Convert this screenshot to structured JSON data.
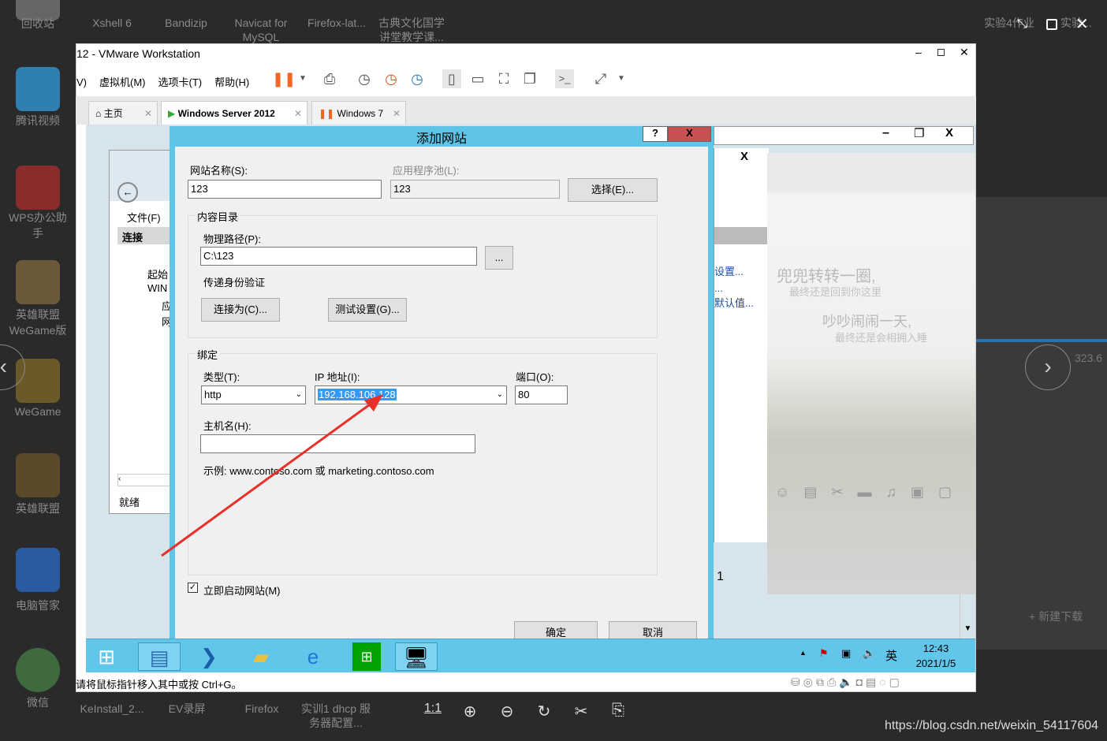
{
  "desktop": {
    "left_icons": [
      "回收站",
      "腾讯视频",
      "WPS办公助手",
      "英雄联盟WeGame版",
      "WeGame",
      "英雄联盟",
      "电脑管家",
      "微信"
    ],
    "top_icons": [
      "Xshell 6",
      "Bandizip",
      "Navicat for MySQL",
      "Firefox-lat...",
      "古典文化国学讲堂教学课..."
    ],
    "top_right": [
      "实验4作业",
      "实验..."
    ]
  },
  "vmware": {
    "title": "12 - VMware Workstation",
    "menu": [
      "V)",
      "虚拟机(M)",
      "选项卡(T)",
      "帮助(H)"
    ],
    "tabs": [
      {
        "label": "主页"
      },
      {
        "label": "Windows Server 2012"
      },
      {
        "label": "Windows 7"
      }
    ],
    "status": "请将鼠标指针移入其中或按 Ctrl+G。"
  },
  "iis": {
    "file_menu": "文件(F)",
    "connections": "连接",
    "tree": [
      "起始",
      "WIN",
      "应",
      "网"
    ],
    "status": "就绪",
    "links": [
      "设置...",
      "...",
      "默认值..."
    ],
    "num": "1"
  },
  "dialog": {
    "title": "添加网站",
    "help": "?",
    "close": "X",
    "site_name_label": "网站名称(S):",
    "site_name": "123",
    "app_pool_label": "应用程序池(L):",
    "app_pool": "123",
    "select_btn": "选择(E)...",
    "content_dir": "内容目录",
    "physical_path_label": "物理路径(P):",
    "physical_path": "C:\\123",
    "browse_btn": "...",
    "passthrough": "传递身份验证",
    "connect_as": "连接为(C)...",
    "test_settings": "测试设置(G)...",
    "binding": "绑定",
    "type_label": "类型(T):",
    "type": "http",
    "ip_label": "IP 地址(I):",
    "ip": "192.168.106.128",
    "port_label": "端口(O):",
    "port": "80",
    "host_label": "主机名(H):",
    "host": "",
    "example": "示例: www.contoso.com 或 marketing.contoso.com",
    "start_now": "立即启动网站(M)",
    "start_checked": true,
    "ok": "确定",
    "cancel": "取消"
  },
  "guest_taskbar": {
    "time": "12:43",
    "date": "2021/1/5",
    "ime": "英"
  },
  "viewer": {
    "labels": [
      "KeInstall_2...",
      "EV录屏",
      "Firefox",
      "实训1 dhcp 服务器配置..."
    ],
    "actual_size": "1:1",
    "side_value": "323.6",
    "new_download": "+ 新建下载",
    "image_text": [
      "兜兜转转一圈,",
      "最终还是回到你这里",
      "吵吵闹闹一天,",
      "最终还是会相拥入睡"
    ]
  },
  "watermark": "https://blog.csdn.net/weixin_54117604",
  "colors": {
    "accent": "#62c6ea",
    "dialog_close": "#c75050",
    "annotation_arrow": "#e8302a",
    "pause": "#f26522"
  }
}
